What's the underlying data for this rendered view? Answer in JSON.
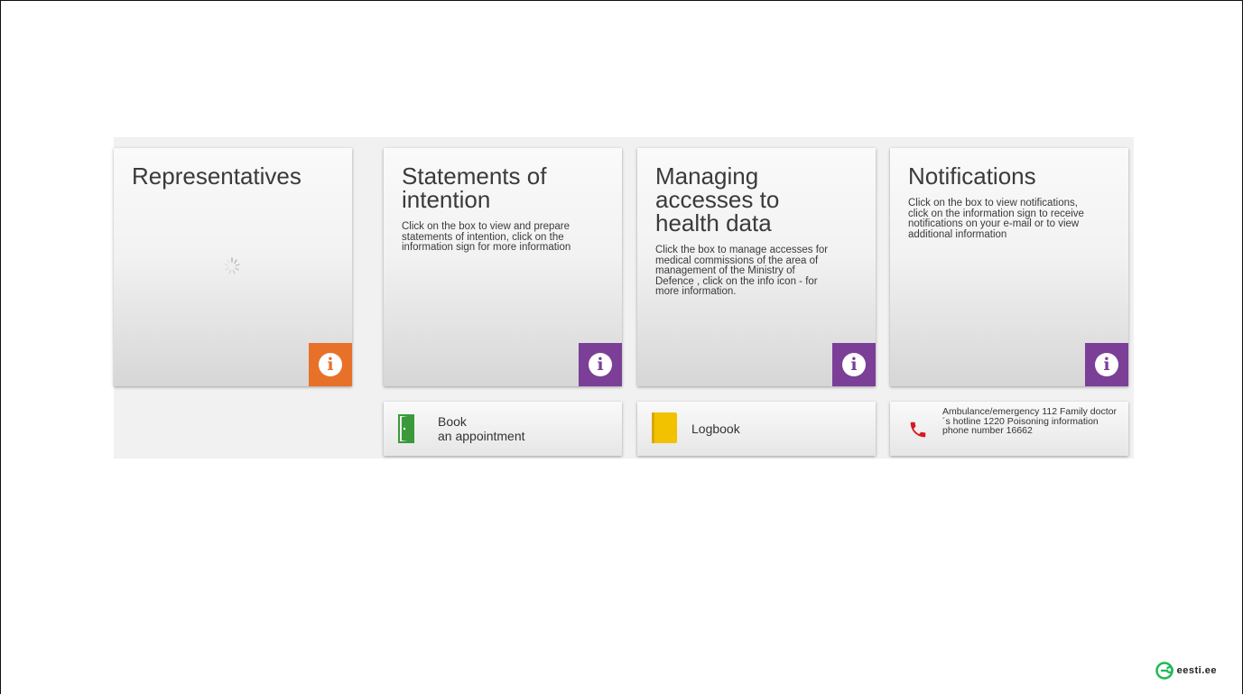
{
  "tiles": [
    {
      "title": "Representatives",
      "text": "",
      "info_color": "orange"
    },
    {
      "title": "Statements of intention",
      "text": "Click on the box to view and prepare statements of intention, click on the information sign for more information",
      "info_color": "purple"
    },
    {
      "title": "Managing accesses to health data",
      "text": "Click the box to manage accesses for medical commissions of the area of management of the Ministry of Defence , click on the info icon - for more information.",
      "info_color": "purple"
    },
    {
      "title": "Notifications",
      "text": "Click on the box to view notifications, click on the information sign to receive notifications on your e-mail or to view additional information",
      "info_color": "purple"
    }
  ],
  "actions": {
    "book_line1": "Book",
    "book_line2": "an appointment",
    "logbook": "Logbook",
    "phones": "Ambulance/emergency 112 Family doctor´s hotline 1220 Poisoning information phone number 16662"
  },
  "brand": {
    "text": "eesti.ee"
  },
  "colors": {
    "orange": "#e8712a",
    "purple": "#7b3f98",
    "green": "#3a9a3a",
    "yellow": "#f2c200",
    "red": "#d71920"
  }
}
